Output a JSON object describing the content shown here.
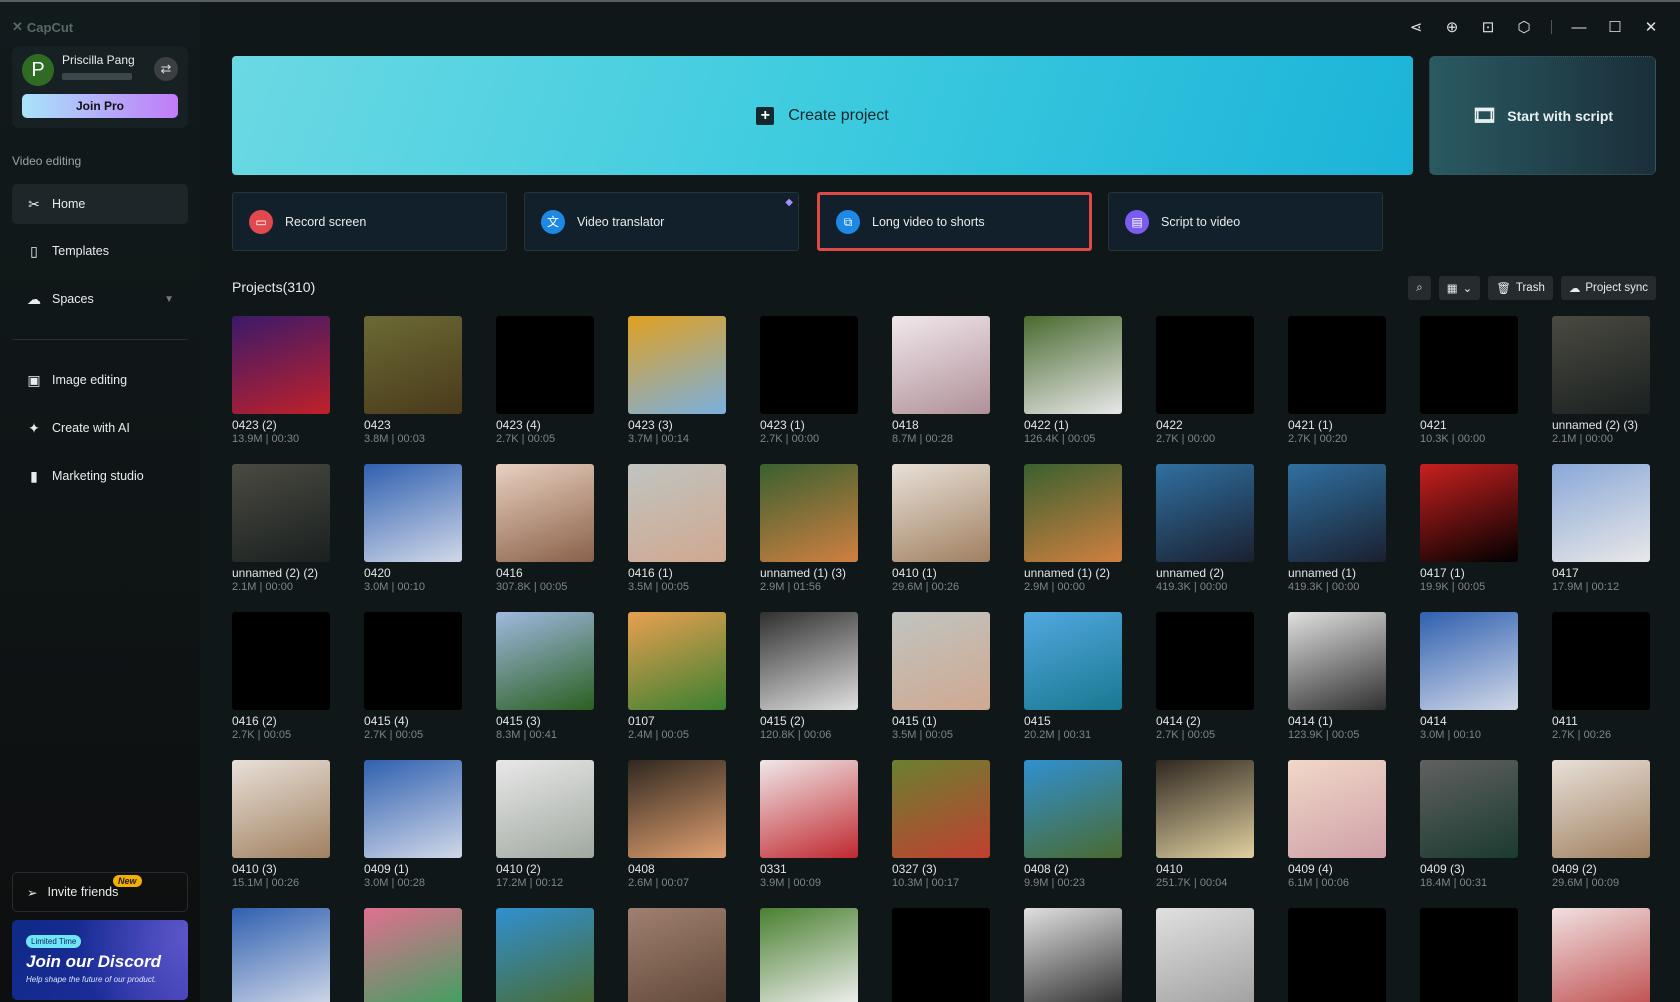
{
  "app": {
    "logo": "CapCut"
  },
  "user": {
    "name": "Priscilla Pang",
    "initial": "P",
    "join_pro": "Join Pro"
  },
  "sidebar": {
    "section": "Video editing",
    "items": [
      {
        "label": "Home",
        "icon": "✂"
      },
      {
        "label": "Templates",
        "icon": "▯"
      },
      {
        "label": "Spaces",
        "icon": "☁"
      },
      {
        "label": "Image editing",
        "icon": "▣"
      },
      {
        "label": "Create with AI",
        "icon": "✦"
      },
      {
        "label": "Marketing studio",
        "icon": "▮"
      }
    ],
    "invite": "Invite friends",
    "invite_badge": "New",
    "promo": {
      "badge": "Limited Time",
      "title": "Join our Discord",
      "subtitle": "Help shape the future of our product."
    }
  },
  "main": {
    "create": "Create project",
    "script": "Start with script",
    "features": [
      {
        "label": "Record screen",
        "color": "#e04a4e",
        "icon": "▭"
      },
      {
        "label": "Video translator",
        "color": "#1e88e5",
        "icon": "文"
      },
      {
        "label": "Long video to shorts",
        "color": "#1e88e5",
        "icon": "⧉"
      },
      {
        "label": "Script to video",
        "color": "#7b5cf0",
        "icon": "▤"
      }
    ],
    "projects_title": "Projects(310)",
    "trash": "Trash",
    "sync": "Project sync"
  },
  "projects": [
    {
      "n": "0423 (2)",
      "m": "13.9M | 00:30",
      "c": [
        "#3a1a6a",
        "#c0202a"
      ]
    },
    {
      "n": "0423",
      "m": "3.8M | 00:03",
      "c": [
        "#6b6a35",
        "#4a3a1a"
      ]
    },
    {
      "n": "0423 (4)",
      "m": "2.7K | 00:05",
      "c": [
        "#000",
        "#000"
      ]
    },
    {
      "n": "0423 (3)",
      "m": "3.7M | 00:14",
      "c": [
        "#e0a020",
        "#7ab0e0"
      ]
    },
    {
      "n": "0423 (1)",
      "m": "2.7K | 00:00",
      "c": [
        "#000",
        "#000"
      ]
    },
    {
      "n": "0418",
      "m": "8.7M | 00:28",
      "c": [
        "#f0e8ec",
        "#b09098"
      ]
    },
    {
      "n": "0422 (1)",
      "m": "126.4K | 00:05",
      "c": [
        "#4a6a30",
        "#e8e8e8"
      ]
    },
    {
      "n": "0422",
      "m": "2.7K | 00:00",
      "c": [
        "#000",
        "#000"
      ]
    },
    {
      "n": "0421 (1)",
      "m": "2.7K | 00:20",
      "c": [
        "#000",
        "#000"
      ]
    },
    {
      "n": "0421",
      "m": "10.3K | 00:00",
      "c": [
        "#000",
        "#000"
      ]
    },
    {
      "n": "unnamed (2) (3)",
      "m": "2.1M | 00:00",
      "c": [
        "#4a4a40",
        "#1a2020"
      ]
    },
    {
      "n": "unnamed (2) (2)",
      "m": "2.1M | 00:00",
      "c": [
        "#4a4a40",
        "#1a2020"
      ]
    },
    {
      "n": "0420",
      "m": "3.0M | 00:10",
      "c": [
        "#3060b0",
        "#d0d8e8"
      ]
    },
    {
      "n": "0416",
      "m": "307.8K | 00:05",
      "c": [
        "#e8d0c0",
        "#8a6048"
      ]
    },
    {
      "n": "0416 (1)",
      "m": "3.5M | 00:05",
      "c": [
        "#c0c4c0",
        "#d0a890"
      ]
    },
    {
      "n": "unnamed (1) (3)",
      "m": "2.9M | 01:56",
      "c": [
        "#3a6030",
        "#d08040"
      ]
    },
    {
      "n": "0410 (1)",
      "m": "29.6M | 00:26",
      "c": [
        "#e8e0d8",
        "#a08060"
      ]
    },
    {
      "n": "unnamed (1) (2)",
      "m": "2.9M | 00:00",
      "c": [
        "#3a6030",
        "#d08040"
      ]
    },
    {
      "n": "unnamed (2)",
      "m": "419.3K | 00:00",
      "c": [
        "#3070a0",
        "#1a2030"
      ]
    },
    {
      "n": "unnamed (1)",
      "m": "419.3K | 00:00",
      "c": [
        "#3070a0",
        "#1a2030"
      ]
    },
    {
      "n": "0417 (1)",
      "m": "19.9K | 00:05",
      "c": [
        "#c82020",
        "#000"
      ]
    },
    {
      "n": "0417",
      "m": "17.9M | 00:12",
      "c": [
        "#8aa8d8",
        "#e8e8e8"
      ]
    },
    {
      "n": "0416 (2)",
      "m": "2.7K | 00:05",
      "c": [
        "#000",
        "#000"
      ]
    },
    {
      "n": "0415 (4)",
      "m": "2.7K | 00:05",
      "c": [
        "#000",
        "#000"
      ]
    },
    {
      "n": "0415 (3)",
      "m": "8.3M | 00:41",
      "c": [
        "#a0b8e0",
        "#2a6020"
      ]
    },
    {
      "n": "0107",
      "m": "2.4M | 00:05",
      "c": [
        "#e8a050",
        "#3a8030"
      ]
    },
    {
      "n": "0415 (2)",
      "m": "120.8K | 00:06",
      "c": [
        "#303030",
        "#e0e0e0"
      ]
    },
    {
      "n": "0415 (1)",
      "m": "3.5M | 00:05",
      "c": [
        "#c0c4c0",
        "#d0a890"
      ]
    },
    {
      "n": "0415",
      "m": "20.2M | 00:31",
      "c": [
        "#50a8e0",
        "#1a7890"
      ]
    },
    {
      "n": "0414 (2)",
      "m": "2.7K | 00:05",
      "c": [
        "#000",
        "#000"
      ]
    },
    {
      "n": "0414 (1)",
      "m": "123.9K | 00:05",
      "c": [
        "#e0e0e0",
        "#303030"
      ]
    },
    {
      "n": "0414",
      "m": "3.0M | 00:10",
      "c": [
        "#3060b0",
        "#d0d8e8"
      ]
    },
    {
      "n": "0411",
      "m": "2.7K | 00:26",
      "c": [
        "#000",
        "#000"
      ]
    },
    {
      "n": "0410 (3)",
      "m": "15.1M | 00:26",
      "c": [
        "#e8e0d8",
        "#a08060"
      ]
    },
    {
      "n": "0409 (1)",
      "m": "3.0M | 00:28",
      "c": [
        "#3060b0",
        "#d0d8e8"
      ]
    },
    {
      "n": "0410 (2)",
      "m": "17.2M | 00:12",
      "c": [
        "#e8e8e8",
        "#a0a8a0"
      ]
    },
    {
      "n": "0408",
      "m": "2.6M | 00:07",
      "c": [
        "#302820",
        "#e0a070"
      ]
    },
    {
      "n": "0331",
      "m": "3.9M | 00:09",
      "c": [
        "#f0e8e8",
        "#c02830"
      ]
    },
    {
      "n": "0327 (3)",
      "m": "10.3M | 00:17",
      "c": [
        "#6a8030",
        "#c04030"
      ]
    },
    {
      "n": "0408 (2)",
      "m": "9.9M | 00:23",
      "c": [
        "#3090d0",
        "#4a6a30"
      ]
    },
    {
      "n": "0410",
      "m": "251.7K | 00:04",
      "c": [
        "#302820",
        "#e0d0a0"
      ]
    },
    {
      "n": "0409 (4)",
      "m": "6.1M | 00:06",
      "c": [
        "#f0d8c8",
        "#d0a0a8"
      ]
    },
    {
      "n": "0409 (3)",
      "m": "18.4M | 00:31",
      "c": [
        "#606060",
        "#1a3a30"
      ]
    },
    {
      "n": "0409 (2)",
      "m": "29.6M | 00:09",
      "c": [
        "#e8e0d8",
        "#a08060"
      ]
    },
    {
      "c": [
        "#3060b0",
        "#d0d8e8"
      ]
    },
    {
      "c": [
        "#e07090",
        "#40a060"
      ]
    },
    {
      "c": [
        "#3090d0",
        "#4a6a30"
      ]
    },
    {
      "c": [
        "#a08070",
        "#604838"
      ]
    },
    {
      "c": [
        "#4a8030",
        "#f0f0f0"
      ]
    },
    {
      "c": [
        "#000",
        "#000"
      ]
    },
    {
      "c": [
        "#e0e0e0",
        "#303030"
      ]
    },
    {
      "c": [
        "#e0e0e0",
        "#a0a0a0"
      ]
    },
    {
      "c": [
        "#000",
        "#000"
      ]
    },
    {
      "c": [
        "#000",
        "#000"
      ]
    },
    {
      "c": [
        "#f0e0e0",
        "#c05050"
      ]
    }
  ]
}
